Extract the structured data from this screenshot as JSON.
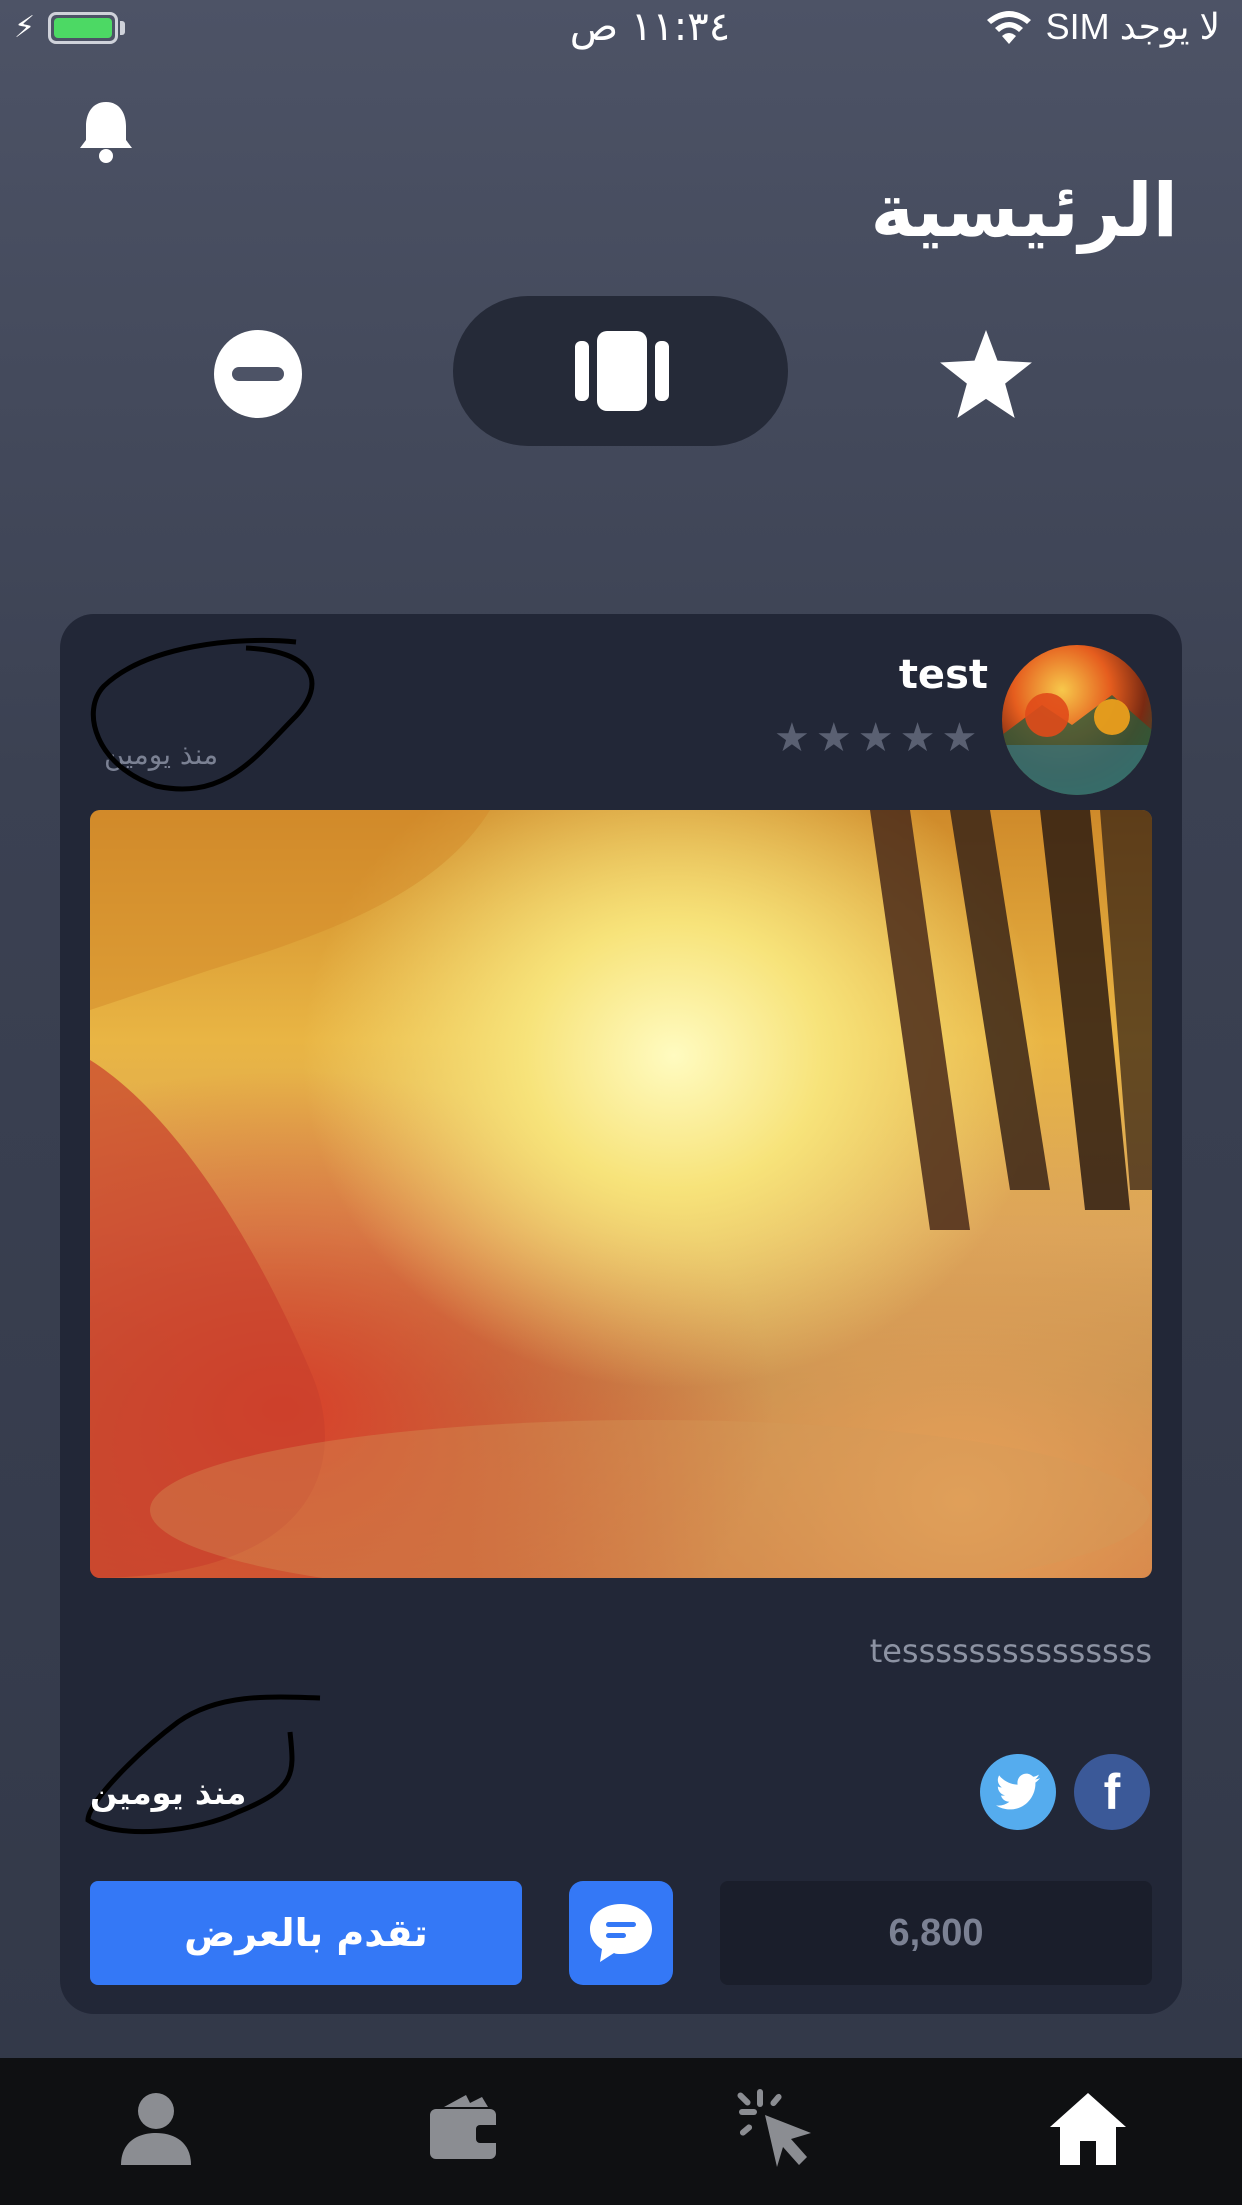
{
  "status_bar": {
    "time": "١١:٣٤ ص",
    "carrier": "لا يوجد SIM",
    "battery_level": 1.0
  },
  "header": {
    "title": "الرئيسية"
  },
  "view_toggle": {
    "items": [
      "minus-circle-icon",
      "cards-icon",
      "star-icon"
    ],
    "selected": "cards-icon"
  },
  "post": {
    "username": "test",
    "rating": 0,
    "rating_max": 5,
    "time_ago_top": "منذ يومين",
    "description": "tesssssssssssssss",
    "time_ago_bottom": "منذ يومين",
    "price": "6,800",
    "offer_button": "تقدم بالعرض"
  },
  "colors": {
    "accent": "#3478f6",
    "card": "#222737",
    "facebook": "#3b5998",
    "twitter": "#55acee"
  },
  "tabbar": {
    "items": [
      "profile-icon",
      "wallet-icon",
      "click-icon",
      "home-icon"
    ],
    "active": "home-icon"
  }
}
